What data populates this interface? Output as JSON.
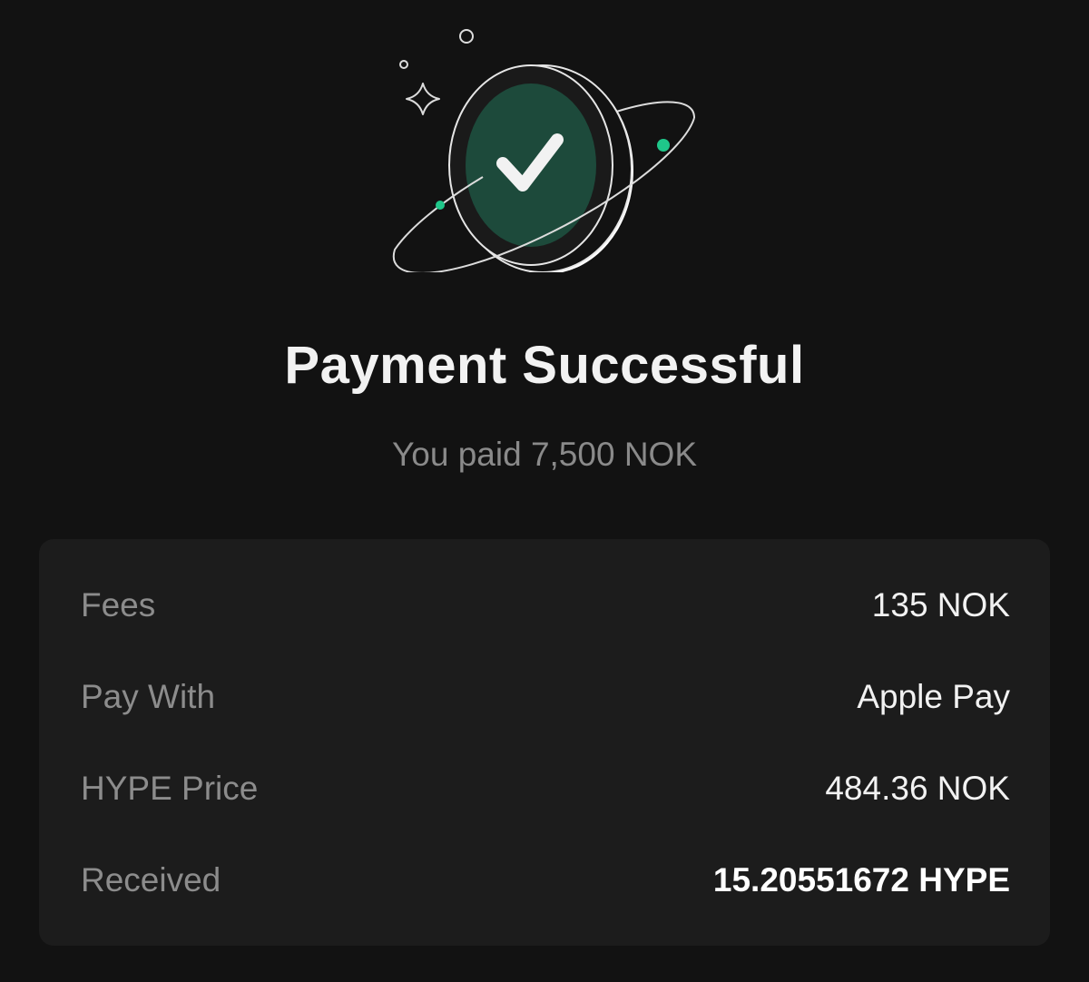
{
  "title": "Payment Successful",
  "subtitle": "You paid 7,500 NOK",
  "details": [
    {
      "label": "Fees",
      "value": "135 NOK",
      "emphasis": false
    },
    {
      "label": "Pay With",
      "value": "Apple Pay",
      "emphasis": false
    },
    {
      "label": "HYPE Price",
      "value": "484.36 NOK",
      "emphasis": false
    },
    {
      "label": "Received",
      "value": "15.20551672 HYPE",
      "emphasis": true
    }
  ],
  "colors": {
    "background": "#121212",
    "card": "#1c1c1c",
    "accent": "#1fc78a",
    "coin_fill": "#1d4a3b"
  },
  "icons": {
    "hero": "success-checkmark-coin-icon"
  }
}
